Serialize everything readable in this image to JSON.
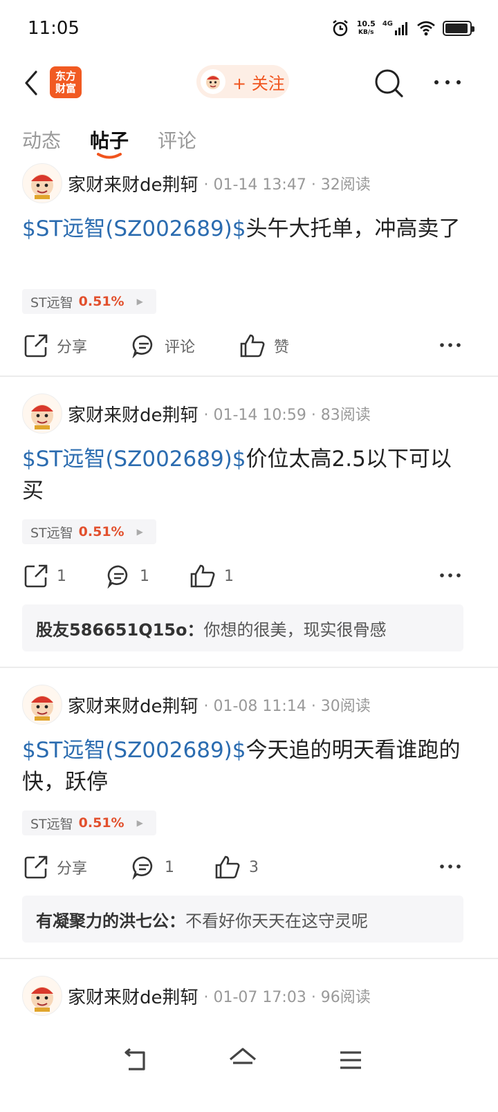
{
  "status_bar": {
    "time": "11:05",
    "net_speed": "10.5",
    "net_unit": "KB/s",
    "signal_label": "4G"
  },
  "header": {
    "logo_text_line1": "东方",
    "logo_text_line2": "财富",
    "follow_label": "+ 关注"
  },
  "tabs": [
    {
      "label": "动态"
    },
    {
      "label": "帖子"
    },
    {
      "label": "评论"
    }
  ],
  "posts": [
    {
      "author": "家财来财de荆轲",
      "meta": "· 01-14 13:47 · 32阅读",
      "tag": "$ST远智(SZ002689)$",
      "text": "头午大托单，冲高卖了",
      "stock_name": "ST远智",
      "stock_change": "0.51%",
      "share_label": "分享",
      "comment_label": "评论",
      "like_label": "赞"
    },
    {
      "author": "家财来财de荆轲",
      "meta": "· 01-14 10:59 · 83阅读",
      "tag": "$ST远智(SZ002689)$",
      "text": "价位太高2.5以下可以买",
      "stock_name": "ST远智",
      "stock_change": "0.51%",
      "share_label": "1",
      "comment_label": "1",
      "like_label": "1",
      "comment_user": "股友586651Q15o：",
      "comment_text": "你想的很美，现实很骨感"
    },
    {
      "author": "家财来财de荆轲",
      "meta": "· 01-08 11:14 · 30阅读",
      "tag": "$ST远智(SZ002689)$",
      "text": "今天追的明天看谁跑的快，跃停",
      "stock_name": "ST远智",
      "stock_change": "0.51%",
      "share_label": "分享",
      "comment_label": "1",
      "like_label": "3",
      "comment_user": "有凝聚力的洪七公：",
      "comment_text": "不看好你天天在这守灵呢"
    },
    {
      "author": "家财来财de荆轲",
      "meta": "· 01-07 17:03 · 96阅读"
    }
  ],
  "colors": {
    "accent": "#f0541e",
    "link": "#2b6cb0",
    "up": "#e2502d"
  }
}
